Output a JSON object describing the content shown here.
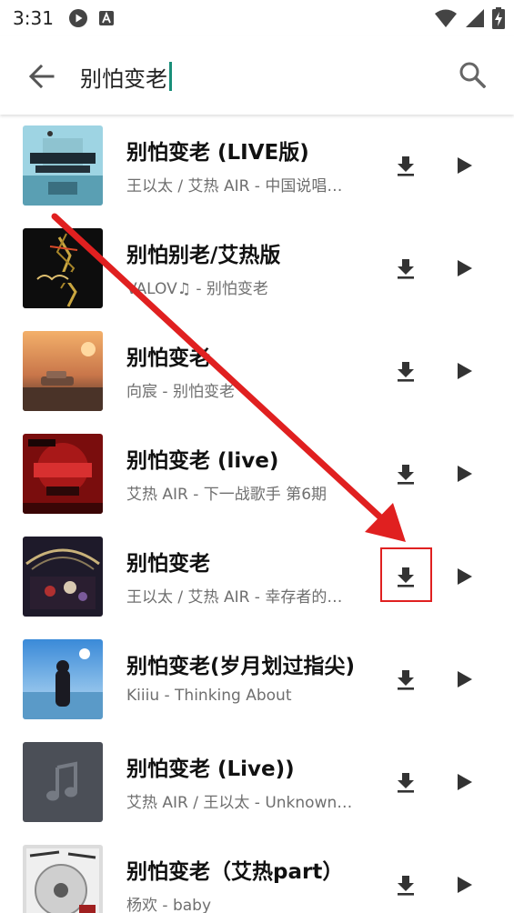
{
  "status_bar": {
    "time": "3:31"
  },
  "search": {
    "query": "别怕变老"
  },
  "results": [
    {
      "title": "别怕变老 (LIVE版)",
      "subtitle": "王以太 / 艾热 AIR - 中国说唱巅峰对决"
    },
    {
      "title": "别怕别老/艾热版",
      "subtitle": "VALOV♫ - 别怕变老"
    },
    {
      "title": "别怕变老",
      "subtitle": "向宸 - 别怕变老"
    },
    {
      "title": "别怕变老 (live)",
      "subtitle": "艾热 AIR - 下一战歌手 第6期"
    },
    {
      "title": "别怕变老",
      "subtitle": "王以太 / 艾热 AIR - 幸存者的狂欢"
    },
    {
      "title": "别怕变老(岁月划过指尖)",
      "subtitle": "Kiiiu - Thinking About"
    },
    {
      "title": "别怕变老 (Live))",
      "subtitle": "艾热 AIR / 王以太 - Unknown Album"
    },
    {
      "title": "别怕变老（艾热part）",
      "subtitle": "杨欢 - baby"
    }
  ],
  "colors": {
    "accent": "#1a8f7a",
    "annotation_red": "#e02020",
    "subtitle_gray": "#6f6f6f",
    "icon_dark": "#333333"
  },
  "icons": {
    "back": "arrow-left-icon",
    "search": "magnifier-icon",
    "download": "download-icon",
    "play": "play-triangle-icon"
  }
}
